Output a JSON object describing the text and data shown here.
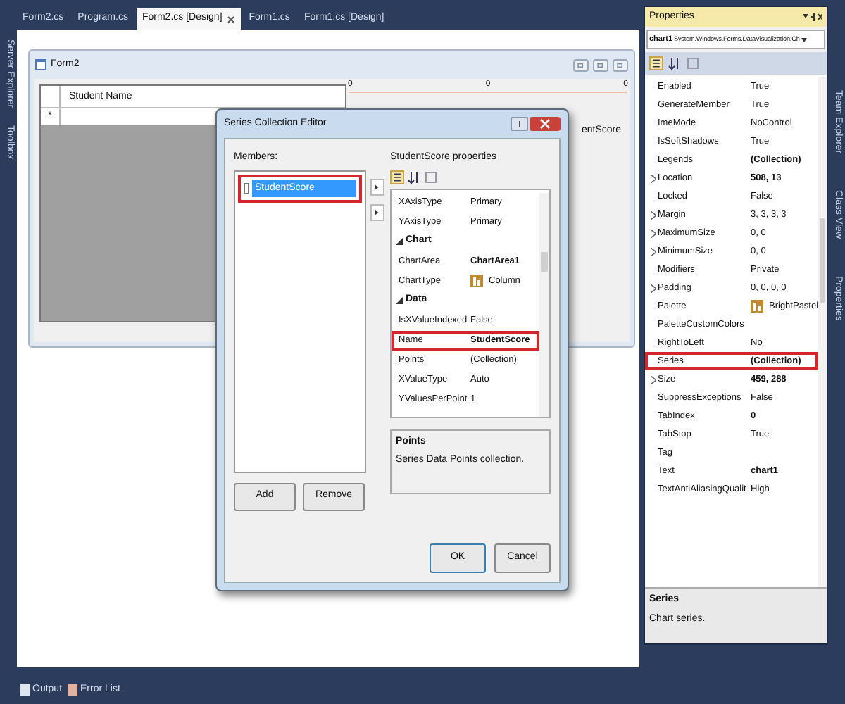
{
  "side_tabs_left": [
    "Server Explorer",
    "Toolbox"
  ],
  "doc_tabs": [
    {
      "label": "Form2.cs",
      "selected": false
    },
    {
      "label": "Program.cs",
      "selected": false
    },
    {
      "label": "Form2.cs [Design]",
      "selected": true
    },
    {
      "label": "Form1.cs",
      "selected": false
    },
    {
      "label": "Form1.cs [Design]",
      "selected": false
    }
  ],
  "form": {
    "title": "Form2",
    "grid": {
      "columns": [
        "Student Name"
      ],
      "new_row_marker": "*"
    },
    "chart": {
      "axis_labels": [
        "0",
        "0",
        "0"
      ],
      "legend": "entScore"
    }
  },
  "dialog": {
    "title": "Series Collection Editor",
    "members_label": "Members:",
    "members": [
      {
        "label": "StudentScore",
        "selected": true,
        "highlighted": true
      }
    ],
    "properties_label": "StudentScore properties",
    "rows": [
      {
        "kind": "property",
        "label": "XAxisType",
        "value": "Primary",
        "bold": false,
        "highlighted": false
      },
      {
        "kind": "property",
        "label": "YAxisType",
        "value": "Primary",
        "bold": false,
        "highlighted": false
      },
      {
        "kind": "category",
        "label": "Chart"
      },
      {
        "kind": "property",
        "label": "ChartArea",
        "value": "ChartArea1",
        "bold": true,
        "highlighted": false
      },
      {
        "kind": "property",
        "label": "ChartType",
        "value": "Column",
        "bold": false,
        "highlighted": false,
        "icon": true
      },
      {
        "kind": "category",
        "label": "Data"
      },
      {
        "kind": "property",
        "label": "IsXValueIndexed",
        "value": "False",
        "bold": false,
        "highlighted": false
      },
      {
        "kind": "property",
        "label": "Name",
        "value": "StudentScore",
        "bold": true,
        "highlighted": true
      },
      {
        "kind": "property",
        "label": "Points",
        "value": "(Collection)",
        "bold": false,
        "highlighted": false
      },
      {
        "kind": "property",
        "label": "XValueType",
        "value": "Auto",
        "bold": false,
        "highlighted": false
      },
      {
        "kind": "property",
        "label": "YValuesPerPoint",
        "value": "1",
        "bold": false,
        "highlighted": false
      }
    ],
    "description": {
      "title": "Points",
      "text": "Series Data Points collection."
    },
    "buttons": [
      "Add",
      "Remove"
    ],
    "footer_buttons": [
      "OK",
      "Cancel"
    ]
  },
  "properties": {
    "title": "Properties",
    "object": {
      "name": "chart1",
      "type": "System.Windows.Forms.DataVisualization.Ch"
    },
    "rows": [
      {
        "label": "Enabled",
        "value": "True",
        "bold": false,
        "expandable": false,
        "highlighted": false
      },
      {
        "label": "GenerateMember",
        "value": "True",
        "bold": false,
        "expandable": false,
        "highlighted": false
      },
      {
        "label": "ImeMode",
        "value": "NoControl",
        "bold": false,
        "expandable": false,
        "highlighted": false
      },
      {
        "label": "IsSoftShadows",
        "value": "True",
        "bold": false,
        "expandable": false,
        "highlighted": false
      },
      {
        "label": "Legends",
        "value": "(Collection)",
        "bold": true,
        "expandable": false,
        "highlighted": false
      },
      {
        "label": "Location",
        "value": "508, 13",
        "bold": true,
        "expandable": true,
        "highlighted": false
      },
      {
        "label": "Locked",
        "value": "False",
        "bold": false,
        "expandable": false,
        "highlighted": false
      },
      {
        "label": "Margin",
        "value": "3, 3, 3, 3",
        "bold": false,
        "expandable": true,
        "highlighted": false
      },
      {
        "label": "MaximumSize",
        "value": "0, 0",
        "bold": false,
        "expandable": true,
        "highlighted": false
      },
      {
        "label": "MinimumSize",
        "value": "0, 0",
        "bold": false,
        "expandable": true,
        "highlighted": false
      },
      {
        "label": "Modifiers",
        "value": "Private",
        "bold": false,
        "expandable": false,
        "highlighted": false
      },
      {
        "label": "Padding",
        "value": "0, 0, 0, 0",
        "bold": false,
        "expandable": true,
        "highlighted": false
      },
      {
        "label": "Palette",
        "value": "BrightPastel",
        "bold": false,
        "expandable": false,
        "highlighted": false,
        "icon": true
      },
      {
        "label": "PaletteCustomColors",
        "expandable": false,
        "highlighted": false
      },
      {
        "label": "RightToLeft",
        "value": "No",
        "bold": false,
        "expandable": false,
        "highlighted": false
      },
      {
        "label": "Series",
        "value": "(Collection)",
        "bold": true,
        "expandable": false,
        "highlighted": true
      },
      {
        "label": "Size",
        "value": "459, 288",
        "bold": true,
        "expandable": true,
        "highlighted": false
      },
      {
        "label": "SuppressExceptions",
        "value": "False",
        "bold": false,
        "expandable": false,
        "highlighted": false
      },
      {
        "label": "TabIndex",
        "value": "0",
        "bold": true,
        "expandable": false,
        "highlighted": false
      },
      {
        "label": "TabStop",
        "value": "True",
        "bold": false,
        "expandable": false,
        "highlighted": false
      },
      {
        "label": "Tag",
        "expandable": false,
        "highlighted": false
      },
      {
        "label": "Text",
        "value": "chart1",
        "bold": true,
        "expandable": false,
        "highlighted": false
      },
      {
        "label": "TextAntiAliasingQualit",
        "value": "High",
        "bold": false,
        "expandable": false,
        "highlighted": false
      }
    ],
    "description": {
      "title": "Series",
      "text": "Chart series."
    }
  },
  "side_tabs_right": [
    "Team Explorer",
    "Class View",
    "Properties"
  ],
  "bottom_tabs": [
    "Output",
    "Error List"
  ]
}
